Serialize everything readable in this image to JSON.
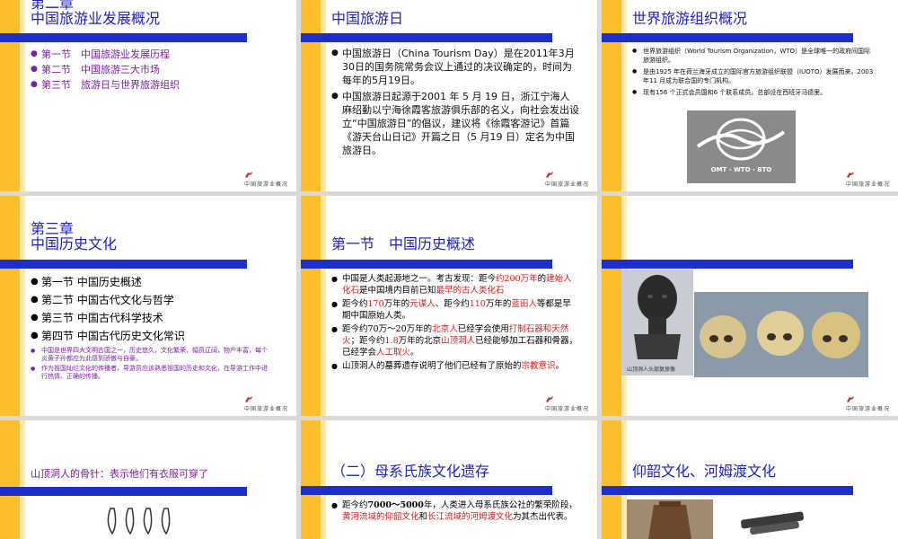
{
  "slides": {
    "s1": {
      "chapter": "第二章",
      "title": "中国旅游业发展概况",
      "items": [
        "第一节　中国旅游业发展历程",
        "第二节　中国旅游三大市场",
        "第三节　旅游日与世界旅游组织"
      ]
    },
    "s2": {
      "title": "中国旅游日",
      "p1": "中国旅游日（China Tourism Day）是在2011年3月30日的国务院常务会议上通过的决议确定的，时间为每年的5月19日。",
      "p2": "中国旅游日起源于2001 年 5 月 19 日，浙江宁海人麻绍勤以宁海徐霞客旅游俱乐部的名义，向社会发出设立“中国旅游日”的倡议，建议将《徐霞客游记》首篇《游天台山日记》开篇之日（5 月19 日）定名为中国旅游日。"
    },
    "s3": {
      "title": "世界旅游组织概况",
      "items": [
        "世界旅游组织（World Tourism Organization，WTO）是全球唯一的政府间国际旅游组织。",
        "是由1925 年在荷兰海牙成立的国际官方旅游组织联盟（IUOTO）发展而来。2003 年11 月成为联合国的专门机构。",
        "现有156 个正式会员国和6 个联系成员。总部设在西班牙马德里。"
      ],
      "logo_text": "OMT - WTO - BTO"
    },
    "s4": {
      "chapter": "第三章",
      "title": "中国历史文化",
      "items": [
        "第一节 中国历史概述",
        "第二节 中国古代文化与哲学",
        "第三节 中国古代科学技术",
        "第四节 中国古代历史文化常识"
      ],
      "notes": [
        "中国是世界四大文明古国之一，历史悠久，文化繁荣，幅员辽阔，物产丰富，每个炎黄子孙都应为此感到骄傲与自豪。",
        "作为祖国灿烂文化的传播者，导游员应该熟悉祖国的历史和文化，在导游工作中进行热情、正确的传播。"
      ]
    },
    "s5": {
      "title": "第一节　中国历史概述",
      "b1": [
        "中国是人类起源地之一。考古发现：距今",
        "约200万年",
        "的",
        "建始人化石",
        "是中国境内目前已知",
        "最早的古人类化石"
      ],
      "b2": [
        "距今约",
        "170",
        "万年的",
        "元谋人",
        "、距今约",
        "110",
        "万年的",
        "蓝田人",
        "等都是早期中国原始人类。"
      ],
      "b3": [
        "距今约70万～20万年的",
        "北京人",
        "已经学会使用",
        "打制石器和天然火",
        "；距今约",
        "1.8",
        "万年的北京",
        "山顶洞人",
        "已经能够加工石器和骨器，已经学会",
        "人工取火",
        "。"
      ],
      "b4": [
        "山顶洞人的墓葬遗存说明了他们已经有了原始的",
        "宗教意识",
        "。"
      ]
    },
    "s6": {
      "caption": "山顶洞人头部复原像"
    },
    "s7": {
      "title": "山顶洞人的骨针：表示他们有衣服可穿了"
    },
    "s8": {
      "title": "（二）母系氏族文化遗存",
      "b1": [
        "距今约",
        "7000～5000",
        "年，人类进入母系氏族公社的繁荣阶段，",
        "黄河流域的仰韶文化",
        "和",
        "长江流域的河姆渡文化",
        "为其杰出代表。"
      ]
    },
    "s9": {
      "title": "仰韶文化、河姆渡文化"
    },
    "footer_text": "中国旅游业概况",
    "colors": {
      "accent_bar": "#1c2fcb",
      "stripe": "#fbbf2e",
      "title": "#1d1ec4",
      "purple": "#7a1fa8",
      "red": "#e01818"
    }
  }
}
